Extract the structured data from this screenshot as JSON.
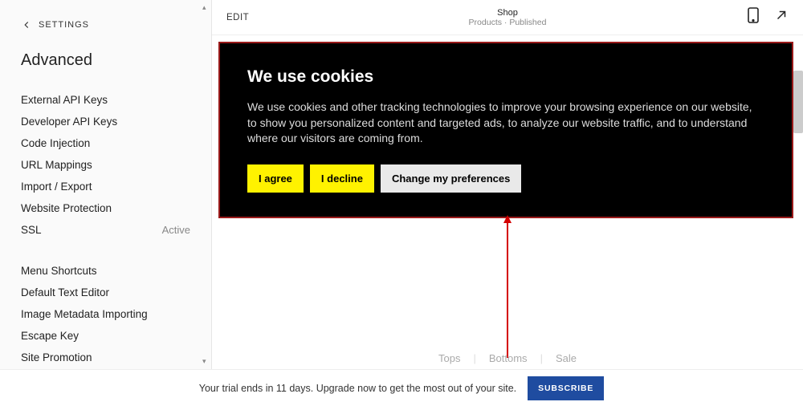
{
  "sidebar": {
    "back_label": "SETTINGS",
    "title": "Advanced",
    "items": [
      {
        "label": "External API Keys",
        "status": ""
      },
      {
        "label": "Developer API Keys",
        "status": ""
      },
      {
        "label": "Code Injection",
        "status": ""
      },
      {
        "label": "URL Mappings",
        "status": ""
      },
      {
        "label": "Import / Export",
        "status": ""
      },
      {
        "label": "Website Protection",
        "status": ""
      },
      {
        "label": "SSL",
        "status": "Active"
      },
      {
        "label": "Menu Shortcuts",
        "status": "",
        "gap": true
      },
      {
        "label": "Default Text Editor",
        "status": ""
      },
      {
        "label": "Image Metadata Importing",
        "status": ""
      },
      {
        "label": "Escape Key",
        "status": ""
      },
      {
        "label": "Site Promotion",
        "status": ""
      }
    ]
  },
  "topbar": {
    "edit": "EDIT",
    "page": "Shop",
    "sub_left": "Products",
    "sub_right": "Published"
  },
  "cookie": {
    "title": "We use cookies",
    "text": "We use cookies and other tracking technologies to improve your browsing experience on our website, to show you personalized content and targeted ads, to analyze our website traffic, and to understand where our visitors are coming from.",
    "agree": "I agree",
    "decline": "I decline",
    "change": "Change my preferences"
  },
  "nav": {
    "a": "Tops",
    "b": "Bottoms",
    "c": "Sale"
  },
  "trial": {
    "text": "Your trial ends in 11 days. Upgrade now to get the most out of your site.",
    "button": "SUBSCRIBE"
  }
}
